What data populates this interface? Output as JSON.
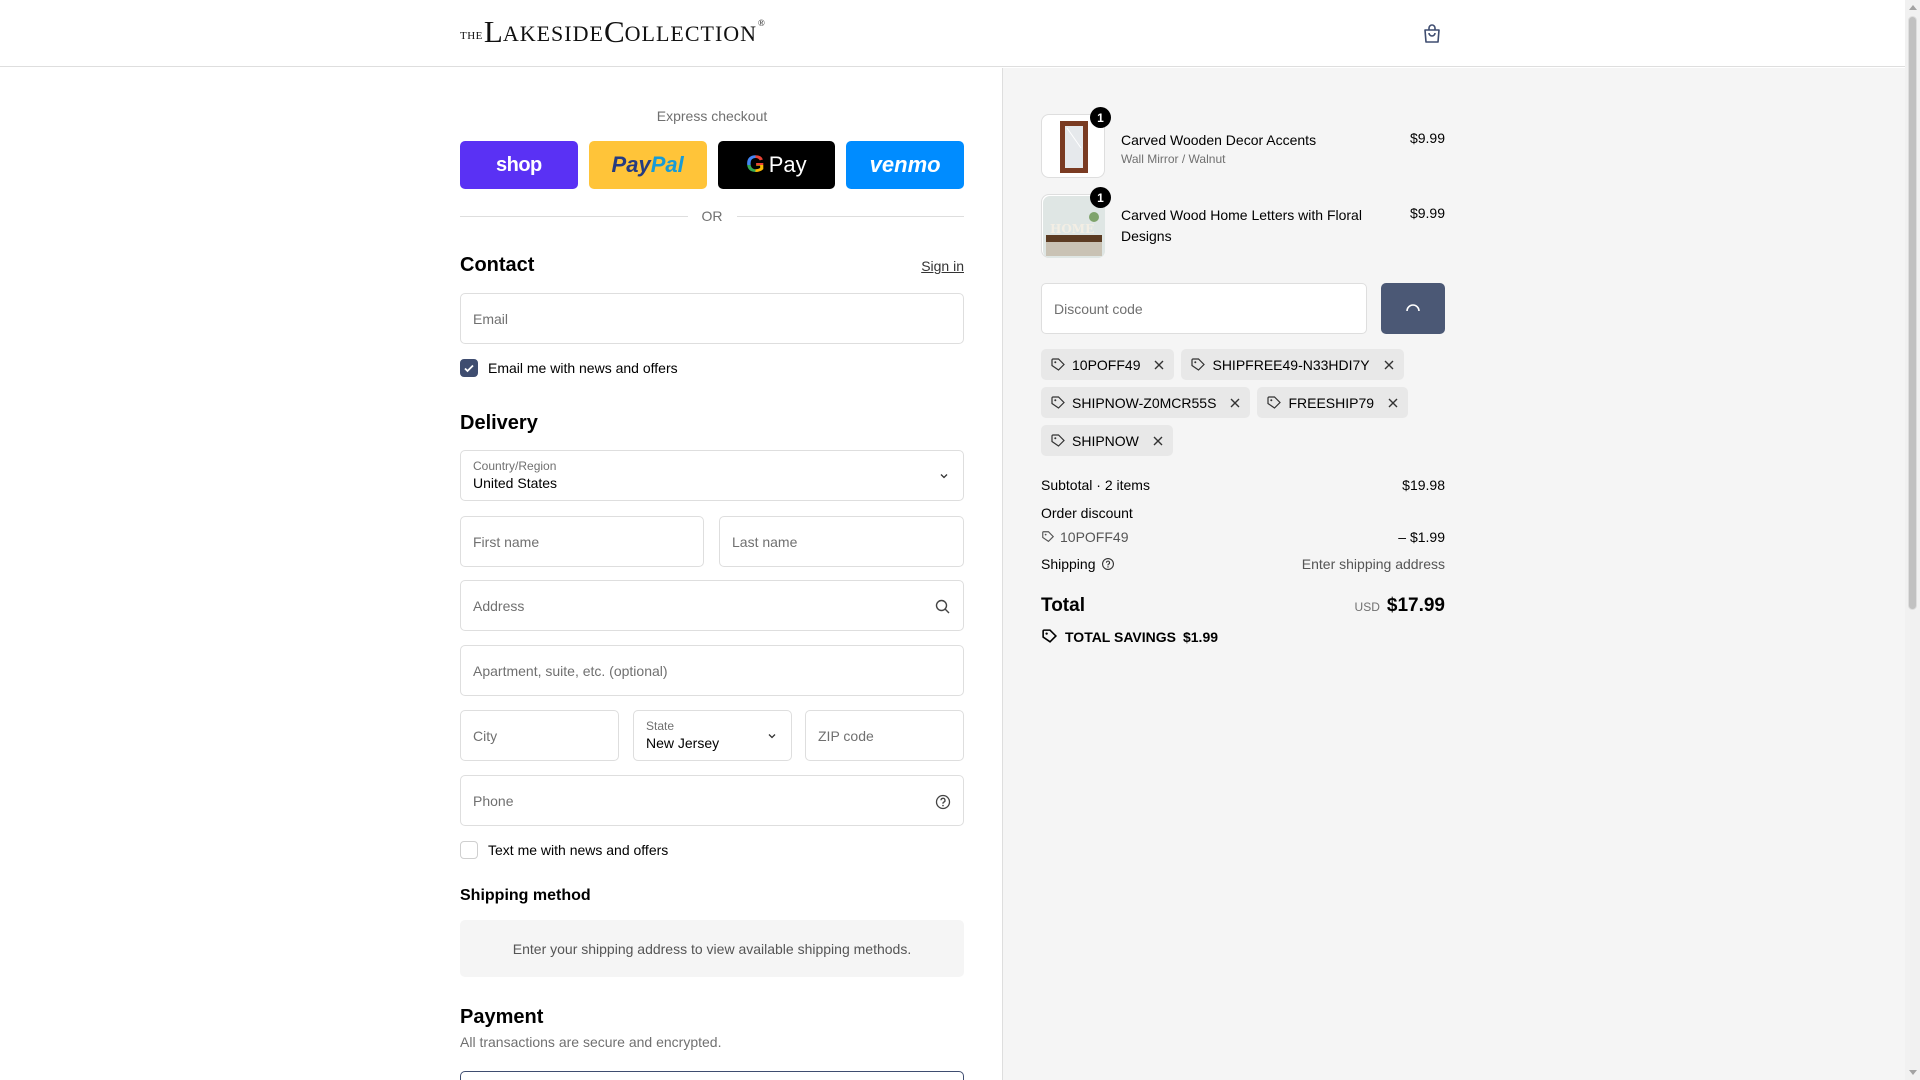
{
  "header": {
    "logo_the": "THE",
    "logo_l": "L",
    "logo_akeside": "AKESIDE ",
    "logo_c": "C",
    "logo_ollection": "OLLECTION",
    "logo_reg": "®"
  },
  "express": {
    "title": "Express checkout",
    "shop": "shop",
    "paypal_1": "Pay",
    "paypal_2": "Pal",
    "gpay_g": "G",
    "gpay": "Pay",
    "venmo": "venmo"
  },
  "or_label": "OR",
  "contact": {
    "title": "Contact",
    "signin": "Sign in",
    "email_placeholder": "Email",
    "news_label": "Email me with news and offers",
    "news_checked": true
  },
  "delivery": {
    "title": "Delivery",
    "country_label": "Country/Region",
    "country_value": "United States",
    "first_name_placeholder": "First name",
    "last_name_placeholder": "Last name",
    "address_placeholder": "Address",
    "apartment_placeholder": "Apartment, suite, etc. (optional)",
    "city_placeholder": "City",
    "state_label": "State",
    "state_value": "New Jersey",
    "zip_placeholder": "ZIP code",
    "phone_placeholder": "Phone",
    "sms_label": "Text me with news and offers",
    "sms_checked": false
  },
  "shipping_method": {
    "title": "Shipping method",
    "message": "Enter your shipping address to view available shipping methods."
  },
  "payment": {
    "title": "Payment",
    "subtitle": "All transactions are secure and encrypted."
  },
  "cart": {
    "items": [
      {
        "name": "Carved Wooden Decor Accents",
        "variant": "Wall Mirror / Walnut",
        "price": "$9.99",
        "qty": "1"
      },
      {
        "name": "Carved Wood Home Letters with Floral Designs",
        "variant": "",
        "price": "$9.99",
        "qty": "1"
      }
    ],
    "discount_placeholder": "Discount code",
    "codes": [
      "10POFF49",
      "SHIPFREE49-N33HDI7Y",
      "SHIPNOW-Z0MCR55S",
      "FREESHIP79",
      "SHIPNOW"
    ]
  },
  "summary": {
    "subtotal_label": "Subtotal · 2 items",
    "subtotal_value": "$19.98",
    "order_discount_label": "Order discount",
    "discount_code": "10POFF49",
    "discount_value": "– $1.99",
    "shipping_label": "Shipping",
    "shipping_value": "Enter shipping address",
    "total_label": "Total",
    "currency": "USD",
    "total_value": "$17.99",
    "savings_label": "TOTAL SAVINGS",
    "savings_value": "$1.99"
  },
  "colors": {
    "accent": "#3f4d70",
    "apply_button": "#4b5875",
    "shop_pay": "#5a31f4",
    "paypal": "#ffc439",
    "venmo": "#008cff"
  }
}
